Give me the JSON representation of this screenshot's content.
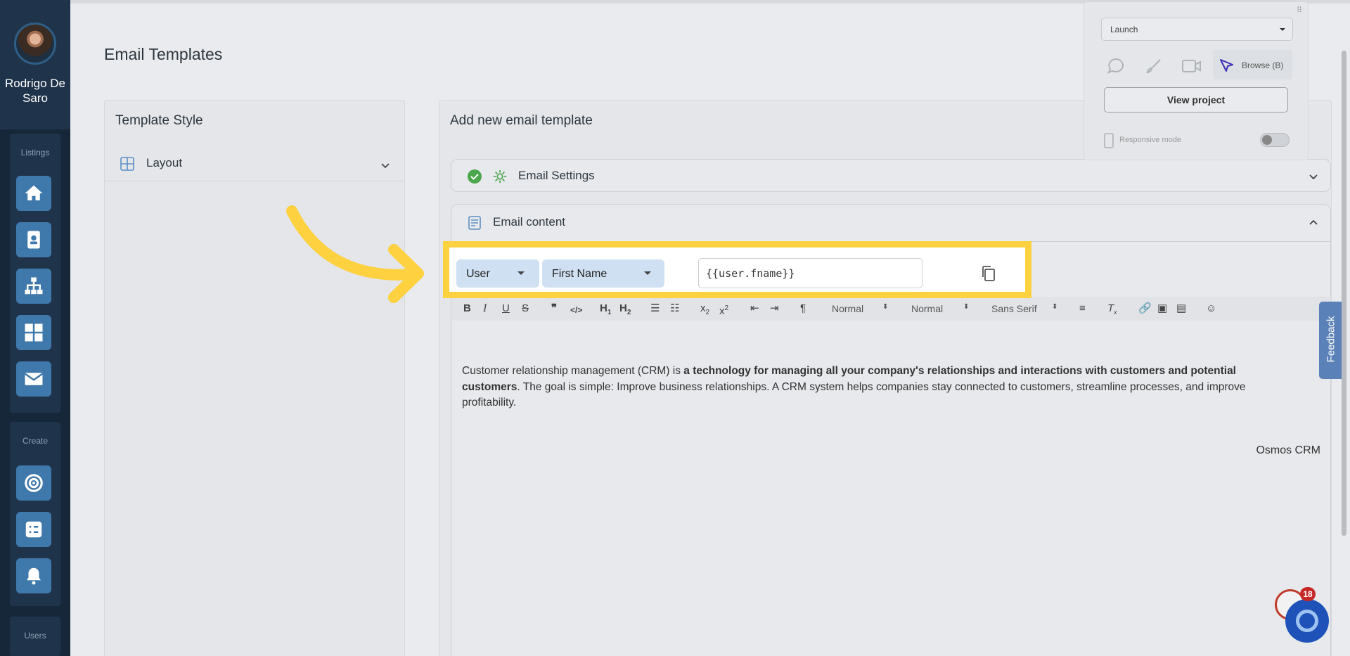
{
  "sidebar": {
    "user_name": "Rodrigo De Saro",
    "sections": {
      "listings": "Listings",
      "create": "Create",
      "users": "Users"
    }
  },
  "page": {
    "title": "Email Templates"
  },
  "template_style": {
    "title": "Template Style",
    "layout_label": "Layout"
  },
  "add_template": {
    "title": "Add new email template",
    "email_settings_label": "Email Settings",
    "email_content_label": "Email content"
  },
  "merge_field": {
    "object_value": "User",
    "field_value": "First Name",
    "code_value": "{{user.fname}}"
  },
  "toolbar": {
    "size_value": "Normal",
    "header_value": "Normal",
    "font_value": "Sans Serif"
  },
  "editor": {
    "text_part1": "Customer relationship management (CRM) is ",
    "text_bold": "a technology for managing all your company's relationships and interactions with customers and potential customers",
    "text_part2": ". The goal is simple: Improve business relationships. A CRM system helps companies stay connected to customers, streamline processes, and improve profitability.",
    "signature": "Osmos CRM"
  },
  "panel": {
    "launch_value": "Launch",
    "browse_label": "Browse (B)",
    "view_project_label": "View project",
    "responsive_mode_label": "Responsive mode"
  },
  "feedback_label": "Feedback",
  "notifications_count": "18",
  "colors": {
    "highlight": "#fdd140",
    "sidebar": "#16273a",
    "accent": "#3f78aa"
  }
}
